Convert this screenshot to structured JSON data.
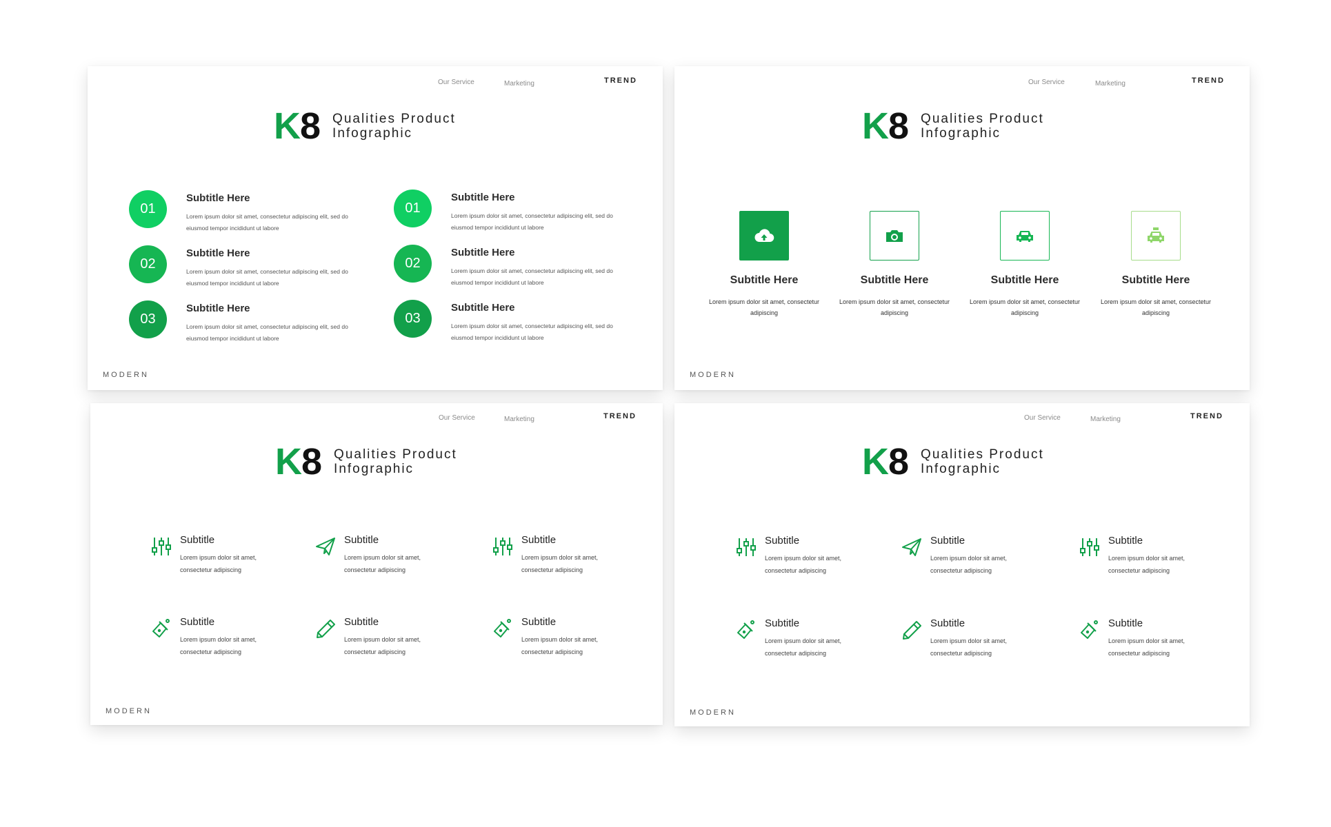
{
  "header": {
    "nav_1": "Our Service",
    "nav_2": "Marketing",
    "brand_right": "TREND"
  },
  "footer": {
    "brand_left": "MODERN"
  },
  "title": {
    "k": "K",
    "eight": "8",
    "line1": "Qualities Product",
    "line2": "Infographic"
  },
  "colors": {
    "green_dark": "#12a04a",
    "green_bright": "#10cf63",
    "green_mid": "#16b653",
    "green_light": "#8fd66a"
  },
  "icons": {
    "slide2": [
      "cloud-upload-icon",
      "camera-icon",
      "car-icon",
      "taxi-icon"
    ],
    "grid": [
      "sliders-icon",
      "paper-plane-icon",
      "sliders-icon",
      "flask-icon",
      "pencil-icon",
      "flask-icon"
    ]
  },
  "slide1": {
    "items": [
      {
        "num": "01",
        "title": "Subtitle Here",
        "desc": "Lorem ipsum dolor sit amet, consectetur adipiscing elit, sed do eiusmod tempor incididunt ut labore"
      },
      {
        "num": "02",
        "title": "Subtitle Here",
        "desc": "Lorem ipsum dolor sit amet, consectetur adipiscing elit, sed do eiusmod tempor incididunt ut labore"
      },
      {
        "num": "03",
        "title": "Subtitle Here",
        "desc": "Lorem ipsum dolor sit amet, consectetur adipiscing elit, sed do eiusmod tempor incididunt ut labore"
      },
      {
        "num": "01",
        "title": "Subtitle Here",
        "desc": "Lorem ipsum dolor sit amet, consectetur adipiscing elit, sed do eiusmod tempor incididunt ut labore"
      },
      {
        "num": "02",
        "title": "Subtitle Here",
        "desc": "Lorem ipsum dolor sit amet, consectetur adipiscing elit, sed do eiusmod tempor incididunt ut labore"
      },
      {
        "num": "03",
        "title": "Subtitle Here",
        "desc": "Lorem ipsum dolor sit amet, consectetur adipiscing elit, sed do eiusmod tempor incididunt ut labore"
      }
    ]
  },
  "slide2": {
    "items": [
      {
        "title": "Subtitle Here",
        "desc": "Lorem ipsum dolor sit amet, consectetur adipiscing"
      },
      {
        "title": "Subtitle Here",
        "desc": "Lorem ipsum dolor sit amet, consectetur adipiscing"
      },
      {
        "title": "Subtitle Here",
        "desc": "Lorem ipsum dolor sit amet, consectetur adipiscing"
      },
      {
        "title": "Subtitle Here",
        "desc": "Lorem ipsum dolor sit amet, consectetur adipiscing"
      }
    ]
  },
  "slide3": {
    "items": [
      {
        "title": "Subtitle",
        "desc": "Lorem ipsum dolor sit amet, consectetur adipiscing"
      },
      {
        "title": "Subtitle",
        "desc": "Lorem ipsum dolor sit amet, consectetur adipiscing"
      },
      {
        "title": "Subtitle",
        "desc": "Lorem ipsum dolor sit amet, consectetur adipiscing"
      },
      {
        "title": "Subtitle",
        "desc": "Lorem ipsum dolor sit amet, consectetur adipiscing"
      },
      {
        "title": "Subtitle",
        "desc": "Lorem ipsum dolor sit amet, consectetur adipiscing"
      },
      {
        "title": "Subtitle",
        "desc": "Lorem ipsum dolor sit amet, consectetur adipiscing"
      }
    ]
  },
  "slide4": {
    "items": [
      {
        "title": "Subtitle",
        "desc": "Lorem ipsum dolor sit amet, consectetur adipiscing"
      },
      {
        "title": "Subtitle",
        "desc": "Lorem ipsum dolor sit amet, consectetur adipiscing"
      },
      {
        "title": "Subtitle",
        "desc": "Lorem ipsum dolor sit amet, consectetur adipiscing"
      },
      {
        "title": "Subtitle",
        "desc": "Lorem ipsum dolor sit amet, consectetur adipiscing"
      },
      {
        "title": "Subtitle",
        "desc": "Lorem ipsum dolor sit amet, consectetur adipiscing"
      },
      {
        "title": "Subtitle",
        "desc": "Lorem ipsum dolor sit amet, consectetur adipiscing"
      }
    ]
  }
}
